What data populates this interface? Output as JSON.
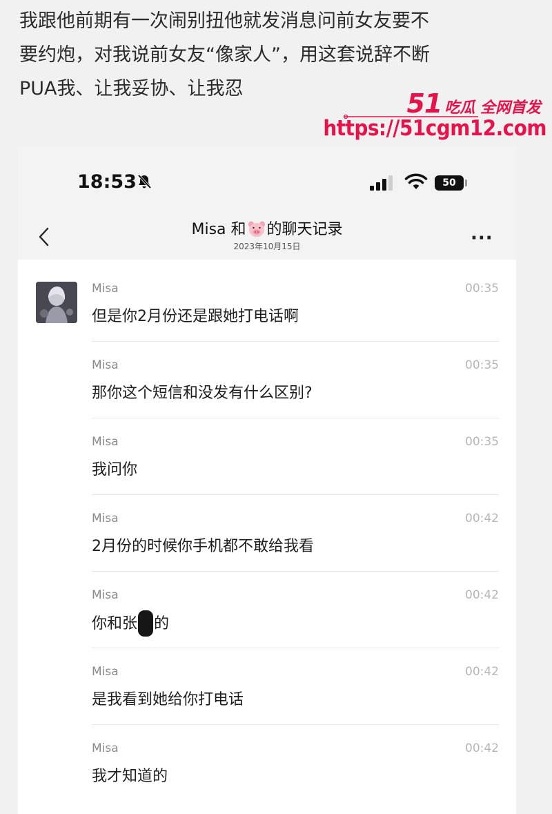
{
  "caption": {
    "lines": [
      "我跟他前期有一次闹别扭他就发消息问前女友要不",
      "要约炮，对我说前女友“像家人”，用这套说辞不断",
      "PUA我、让我妥协、让我忍"
    ]
  },
  "watermark": {
    "number": "51",
    "tagline": "吃瓜 全网首发",
    "url": "https://51cgm12.com",
    "color": "#e8124a"
  },
  "status_bar": {
    "time": "18:53",
    "battery": "50",
    "icons": [
      "bell-slash-icon",
      "signal-icon",
      "wifi-icon",
      "battery-icon"
    ]
  },
  "chat_header": {
    "title_prefix": "Misa 和",
    "title_suffix": "的聊天记录",
    "emoji_icon": "pig-face-icon",
    "date": "2023年10月15日",
    "back_icon": "chevron-left-icon",
    "more_icon": "more-dots-icon",
    "more_glyph": "···"
  },
  "messages": [
    {
      "sender": "Misa",
      "time": "00:35",
      "text": "但是你2月份还是跟她打电话啊"
    },
    {
      "sender": "Misa",
      "time": "00:35",
      "text": "那你这个短信和没发有什么区别?"
    },
    {
      "sender": "Misa",
      "time": "00:35",
      "text": "我问你"
    },
    {
      "sender": "Misa",
      "time": "00:42",
      "text": "2月份的时候你手机都不敢给我看"
    },
    {
      "sender": "Misa",
      "time": "00:42",
      "text_before": "你和张",
      "text_after": "的"
    },
    {
      "sender": "Misa",
      "time": "00:42",
      "text": "是我看到她给你打电话"
    },
    {
      "sender": "Misa",
      "time": "00:42",
      "text": "我才知道的"
    }
  ]
}
